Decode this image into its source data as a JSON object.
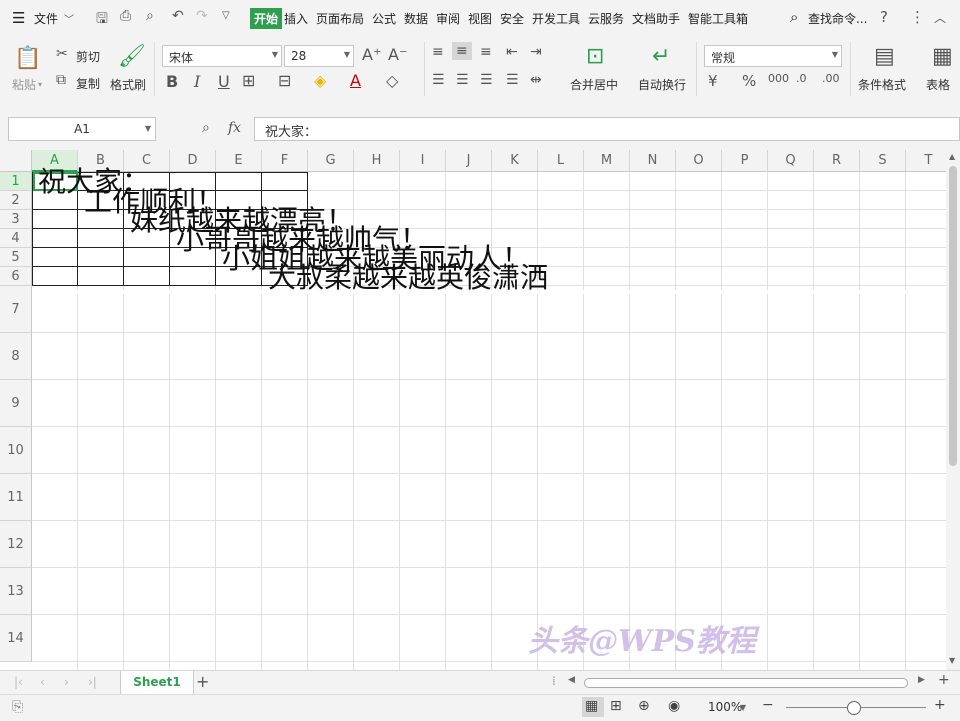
{
  "menu": {
    "file_label": "文件",
    "tabs": [
      "开始",
      "插入",
      "页面布局",
      "公式",
      "数据",
      "审阅",
      "视图",
      "安全",
      "开发工具",
      "云服务",
      "文档助手",
      "智能工具箱"
    ],
    "active_tab": "开始",
    "search_label": "查找命令..."
  },
  "ribbon": {
    "paste_label": "粘贴",
    "cut_label": "剪切",
    "copy_label": "复制",
    "format_painter_label": "格式刷",
    "font_name": "宋体",
    "font_size": "28",
    "merge_center_label": "合并居中",
    "wrap_text_label": "自动换行",
    "number_format": "常规",
    "conditional_format_label": "条件格式",
    "table_style_label": "表格"
  },
  "formula_bar": {
    "name_box": "A1",
    "fx_label": "fx",
    "content": "祝大家："
  },
  "columns": [
    "A",
    "B",
    "C",
    "D",
    "E",
    "F",
    "G",
    "H",
    "I",
    "J",
    "K",
    "L",
    "M",
    "N",
    "O",
    "P",
    "Q",
    "R",
    "S",
    "T"
  ],
  "rows": [
    "1",
    "2",
    "3",
    "4",
    "5",
    "6",
    "7",
    "8",
    "9",
    "10",
    "11",
    "12",
    "13",
    "14"
  ],
  "cells": {
    "r1": "祝大家：",
    "r2": "工作顺利！",
    "r3": "妹纸越来越漂亮！",
    "r4": "小哥哥越来越帅气！",
    "r5": "小姐姐越来越美丽动人！",
    "r6": "大叔柔越来越英俊潇洒"
  },
  "watermark": "头条@WPS教程",
  "sheet_tabs": [
    "Sheet1"
  ],
  "status": {
    "zoom": "100%"
  },
  "colors": {
    "accent": "#2d9f4e",
    "watermark": "#c9b6e6"
  }
}
